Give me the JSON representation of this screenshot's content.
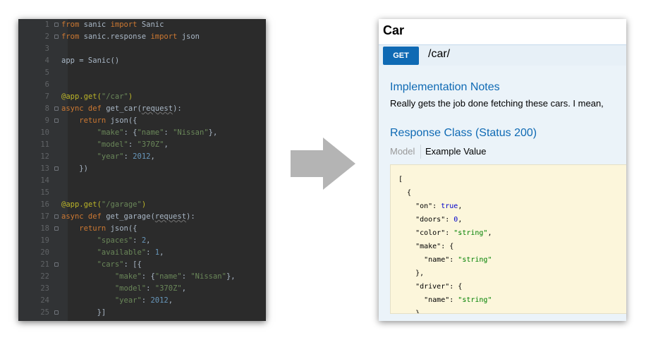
{
  "editor": {
    "lines": [
      {
        "n": "1",
        "fold": true,
        "t": [
          [
            "kw",
            "from"
          ],
          [
            "pl",
            " sanic "
          ],
          [
            "kw",
            "import"
          ],
          [
            "pl",
            " Sanic"
          ]
        ]
      },
      {
        "n": "2",
        "fold": true,
        "t": [
          [
            "kw",
            "from"
          ],
          [
            "pl",
            " sanic.response "
          ],
          [
            "kw",
            "import"
          ],
          [
            "pl",
            " json"
          ]
        ]
      },
      {
        "n": "3",
        "fold": false,
        "t": []
      },
      {
        "n": "4",
        "fold": false,
        "t": [
          [
            "pl",
            "app = Sanic()"
          ]
        ]
      },
      {
        "n": "5",
        "fold": false,
        "t": []
      },
      {
        "n": "6",
        "fold": false,
        "t": []
      },
      {
        "n": "7",
        "fold": false,
        "t": [
          [
            "dec",
            "@app.get("
          ],
          [
            "str",
            "\"/car\""
          ],
          [
            "dec",
            ")"
          ]
        ]
      },
      {
        "n": "8",
        "fold": true,
        "t": [
          [
            "kw",
            "async def"
          ],
          [
            "pl",
            " get_car("
          ],
          [
            "param",
            "request"
          ],
          [
            "pl",
            "):"
          ]
        ]
      },
      {
        "n": "9",
        "fold": true,
        "t": [
          [
            "pl",
            "    "
          ],
          [
            "kw",
            "return"
          ],
          [
            "pl",
            " json({"
          ]
        ]
      },
      {
        "n": "10",
        "fold": false,
        "t": [
          [
            "pl",
            "        "
          ],
          [
            "str",
            "\"make\""
          ],
          [
            "pl",
            ": {"
          ],
          [
            "str",
            "\"name\""
          ],
          [
            "pl",
            ": "
          ],
          [
            "str",
            "\"Nissan\""
          ],
          [
            "pl",
            "},"
          ]
        ]
      },
      {
        "n": "11",
        "fold": false,
        "t": [
          [
            "pl",
            "        "
          ],
          [
            "str",
            "\"model\""
          ],
          [
            "pl",
            ": "
          ],
          [
            "str",
            "\"370Z\""
          ],
          [
            "pl",
            ","
          ]
        ]
      },
      {
        "n": "12",
        "fold": false,
        "t": [
          [
            "pl",
            "        "
          ],
          [
            "str",
            "\"year\""
          ],
          [
            "pl",
            ": "
          ],
          [
            "num",
            "2012"
          ],
          [
            "pl",
            ","
          ]
        ]
      },
      {
        "n": "13",
        "fold": true,
        "t": [
          [
            "pl",
            "    })"
          ]
        ]
      },
      {
        "n": "14",
        "fold": false,
        "t": []
      },
      {
        "n": "15",
        "fold": false,
        "t": []
      },
      {
        "n": "16",
        "fold": false,
        "t": [
          [
            "dec",
            "@app.get("
          ],
          [
            "str",
            "\"/garage\""
          ],
          [
            "dec",
            ")"
          ]
        ]
      },
      {
        "n": "17",
        "fold": true,
        "t": [
          [
            "kw",
            "async def"
          ],
          [
            "pl",
            " get_garage("
          ],
          [
            "param",
            "request"
          ],
          [
            "pl",
            "):"
          ]
        ]
      },
      {
        "n": "18",
        "fold": true,
        "t": [
          [
            "pl",
            "    "
          ],
          [
            "kw",
            "return"
          ],
          [
            "pl",
            " json({"
          ]
        ]
      },
      {
        "n": "19",
        "fold": false,
        "t": [
          [
            "pl",
            "        "
          ],
          [
            "str",
            "\"spaces\""
          ],
          [
            "pl",
            ": "
          ],
          [
            "num",
            "2"
          ],
          [
            "pl",
            ","
          ]
        ]
      },
      {
        "n": "20",
        "fold": false,
        "t": [
          [
            "pl",
            "        "
          ],
          [
            "str",
            "\"available\""
          ],
          [
            "pl",
            ": "
          ],
          [
            "num",
            "1"
          ],
          [
            "pl",
            ","
          ]
        ]
      },
      {
        "n": "21",
        "fold": true,
        "t": [
          [
            "pl",
            "        "
          ],
          [
            "str",
            "\"cars\""
          ],
          [
            "pl",
            ": [{"
          ]
        ]
      },
      {
        "n": "22",
        "fold": false,
        "t": [
          [
            "pl",
            "            "
          ],
          [
            "str",
            "\"make\""
          ],
          [
            "pl",
            ": {"
          ],
          [
            "str",
            "\"name\""
          ],
          [
            "pl",
            ": "
          ],
          [
            "str",
            "\"Nissan\""
          ],
          [
            "pl",
            "},"
          ]
        ]
      },
      {
        "n": "23",
        "fold": false,
        "t": [
          [
            "pl",
            "            "
          ],
          [
            "str",
            "\"model\""
          ],
          [
            "pl",
            ": "
          ],
          [
            "str",
            "\"370Z\""
          ],
          [
            "pl",
            ","
          ]
        ]
      },
      {
        "n": "24",
        "fold": false,
        "t": [
          [
            "pl",
            "            "
          ],
          [
            "str",
            "\"year\""
          ],
          [
            "pl",
            ": "
          ],
          [
            "num",
            "2012"
          ],
          [
            "pl",
            ","
          ]
        ]
      },
      {
        "n": "25",
        "fold": true,
        "t": [
          [
            "pl",
            "        }]"
          ]
        ]
      }
    ]
  },
  "swagger": {
    "title": "Car",
    "method": "GET",
    "path": "/car/",
    "notes_heading": "Implementation Notes",
    "notes_text": "Really gets the job done fetching these cars. I mean,",
    "response_heading": "Response Class (Status 200)",
    "tab_model": "Model",
    "tab_example": "Example Value",
    "sample": [
      [
        [
          "jk",
          "["
        ]
      ],
      [
        [
          "jk",
          "  {"
        ]
      ],
      [
        [
          "jk",
          "    \"on\": "
        ],
        [
          "jb",
          "true"
        ],
        [
          "jk",
          ","
        ]
      ],
      [
        [
          "jk",
          "    \"doors\": "
        ],
        [
          "jn",
          "0"
        ],
        [
          "jk",
          ","
        ]
      ],
      [
        [
          "jk",
          "    \"color\": "
        ],
        [
          "js",
          "\"string\""
        ],
        [
          "jk",
          ","
        ]
      ],
      [
        [
          "jk",
          "    \"make\": {"
        ]
      ],
      [
        [
          "jk",
          "      \"name\": "
        ],
        [
          "js",
          "\"string\""
        ]
      ],
      [
        [
          "jk",
          "    },"
        ]
      ],
      [
        [
          "jk",
          "    \"driver\": {"
        ]
      ],
      [
        [
          "jk",
          "      \"name\": "
        ],
        [
          "js",
          "\"string\""
        ]
      ],
      [
        [
          "jk",
          "    }"
        ]
      ]
    ]
  },
  "colors": {
    "editor_bg": "#2b2b2b",
    "keyword": "#cc7832",
    "string": "#6a8759",
    "number": "#6897bb",
    "decorator": "#bbb529",
    "get_badge": "#0f6ab4",
    "arrow": "#b4b4b4"
  },
  "icons": {
    "arrow": "right-arrow-icon",
    "fold": "code-fold-icon"
  }
}
